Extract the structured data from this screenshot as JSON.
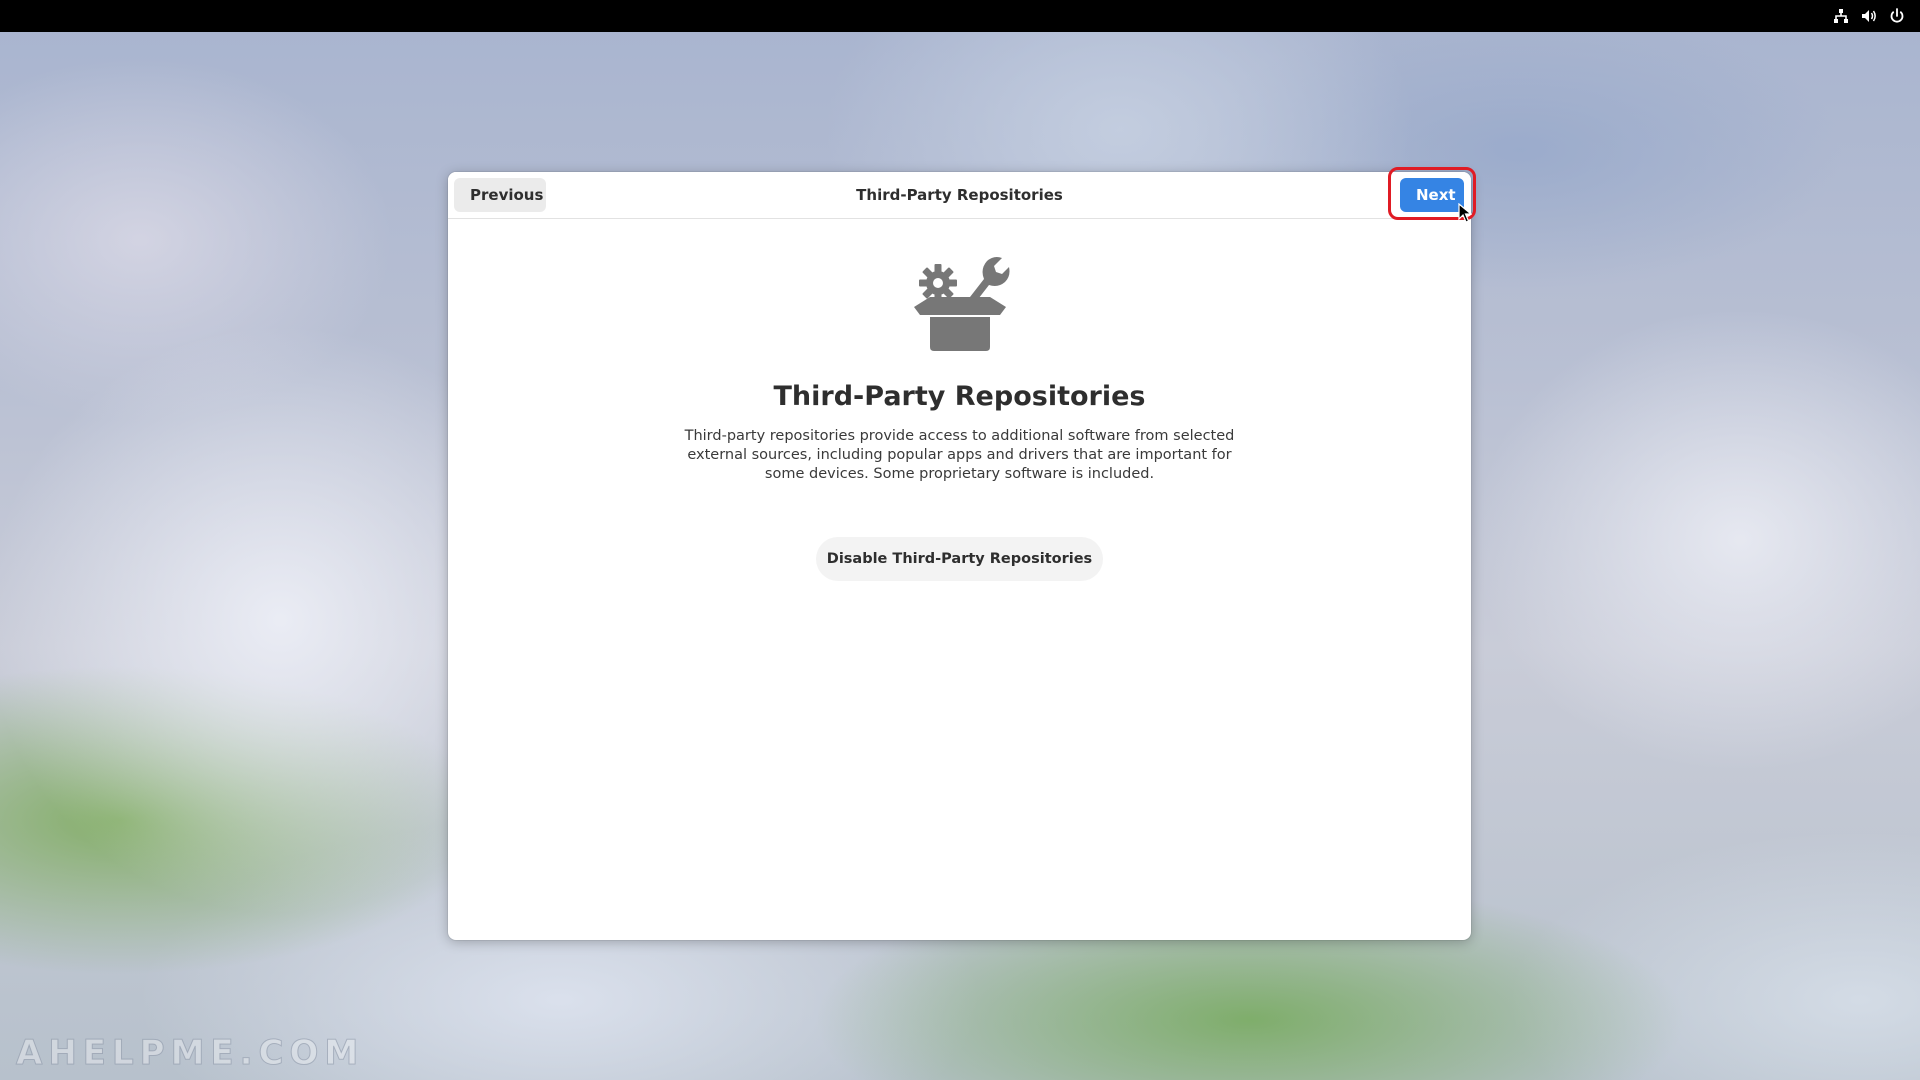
{
  "system": {
    "tray_icons": [
      "network-icon",
      "volume-icon",
      "power-icon"
    ]
  },
  "dialog": {
    "title": "Third-Party Repositories",
    "previous_label": "Previous",
    "next_label": "Next",
    "heading": "Third-Party Repositories",
    "description": "Third-party repositories provide access to additional software from selected external sources, including popular apps and drivers that are important for some devices. Some proprietary software is included.",
    "disable_button_label": "Disable Third-Party Repositories",
    "hero_icon": "gear-wrench-box-icon"
  },
  "colors": {
    "accent": "#3584e4",
    "highlight": "#e01b24"
  },
  "watermark": "AHELPME.COM"
}
